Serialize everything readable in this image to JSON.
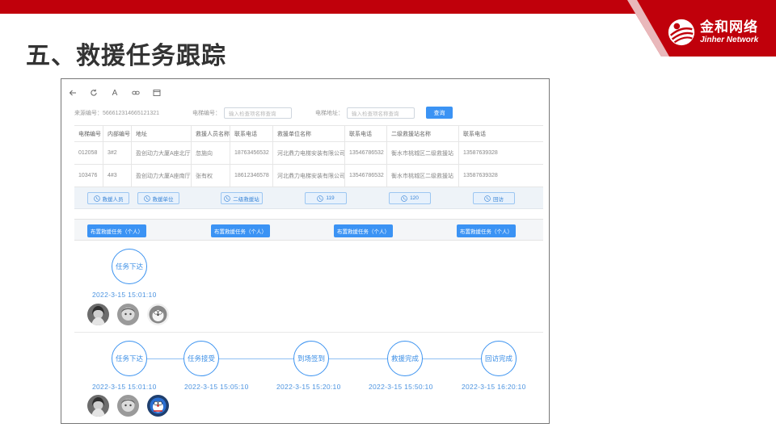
{
  "slide": {
    "title": "五、救援任务跟踪",
    "brand_color": "#c0000b",
    "logo": {
      "cn": "金和网络",
      "en": "Jinher Network"
    }
  },
  "toolbar": {
    "icons": [
      "back-arrow-icon",
      "refresh-icon",
      "text-a-icon",
      "link-icon",
      "window-icon"
    ],
    "text_label": "A"
  },
  "filters": {
    "source_label": "来源编号：",
    "source_value": "566612314665121321",
    "elevator_no_label": "电梯编号：",
    "elevator_no_placeholder": "输入检查项名称查询",
    "elevator_addr_label": "电梯地址：",
    "elevator_addr_placeholder": "输入检查项名称查询",
    "query_button": "查询"
  },
  "table": {
    "headers": [
      "电梯编号",
      "内部编号",
      "地址",
      "救援人员名称",
      "联系电话",
      "救援单位名称",
      "联系电话",
      "二级救援站名称",
      "联系电话"
    ],
    "rows": [
      [
        "012058",
        "3#2",
        "盈创动力大厦A座北厅",
        "忽施向",
        "18763456532",
        "河北鼎力电梯安装有限公司",
        "13546786532",
        "衡水市桃城区二级救援站",
        "13587639328"
      ],
      [
        "103476",
        "4#3",
        "盈创动力大厦A座南厅",
        "张有权",
        "18612346578",
        "河北鼎力电梯安装有限公司",
        "13546786532",
        "衡水市桃城区二级救援站",
        "13587639328"
      ]
    ]
  },
  "call_buttons": [
    "救援人员",
    "救援单位",
    "二级救援站",
    "119",
    "120",
    "回访"
  ],
  "assign_buttons": [
    "布置救援任务（个人）",
    "布置救援任务（个人）",
    "布置救援任务（个人）",
    "布置救援任务（个人）"
  ],
  "track_single": {
    "step": "任务下达",
    "time": "2022-3-15 15:01:10"
  },
  "track_full": {
    "steps": [
      {
        "label": "任务下达",
        "time": "2022-3-15 15:01:10"
      },
      {
        "label": "任务接受",
        "time": "2022-3-15 15:05:10"
      },
      {
        "label": "到场签到",
        "time": "2022-3-15 15:20:10"
      },
      {
        "label": "救援完成",
        "time": "2022-3-15 15:50:10"
      },
      {
        "label": "回访完成",
        "time": "2022-3-15 16:20:10"
      }
    ]
  },
  "colors": {
    "accent": "#3b93f4",
    "node_border": "#3c93f0",
    "timestamp": "#4d94e0"
  }
}
